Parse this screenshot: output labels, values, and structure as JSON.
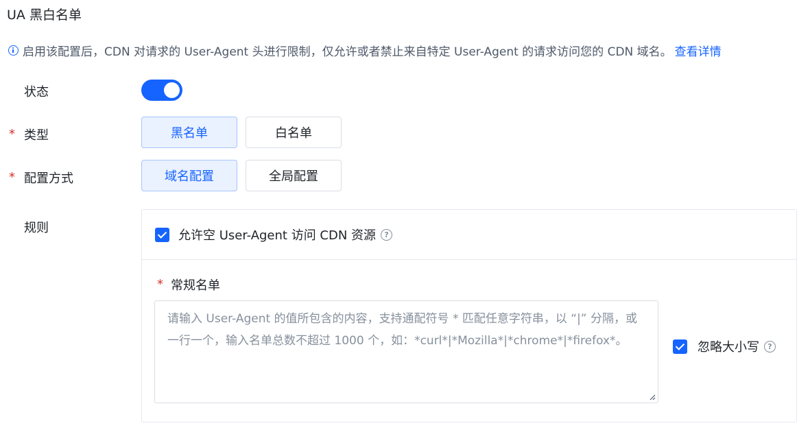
{
  "section": {
    "title": "UA 黑白名单"
  },
  "info": {
    "text": "启用该配置后，CDN 对请求的 User-Agent 头进行限制，仅允许或者禁止来自特定 User-Agent 的请求访问您的 CDN 域名。",
    "link": "查看详情",
    "accent_color": "#1664ff"
  },
  "form": {
    "status": {
      "label": "状态",
      "enabled": true
    },
    "type": {
      "label": "类型",
      "required_mark": "*",
      "options": [
        "黑名单",
        "白名单"
      ],
      "selected": "黑名单"
    },
    "config_mode": {
      "label": "配置方式",
      "required_mark": "*",
      "options": [
        "域名配置",
        "全局配置"
      ],
      "selected": "域名配置"
    },
    "rules": {
      "label": "规则",
      "allow_empty": {
        "label": "允许空 User-Agent 访问 CDN 资源",
        "checked": true
      },
      "list": {
        "required_mark": "*",
        "label": "常规名单",
        "placeholder": "请输入 User-Agent 的值所包含的内容，支持通配符号 * 匹配任意字符串，以 “|” 分隔，或一行一个，输入名单总数不超过 1000 个，如：*curl*|*Mozilla*|*chrome*|*firefox*。",
        "value": ""
      },
      "ignore_case": {
        "label": "忽略大小写",
        "checked": true
      }
    }
  },
  "icons": {
    "info": "info-circle-icon",
    "help": "question-circle-icon",
    "check": "checkmark-icon",
    "resize": "resize-handle-icon"
  }
}
